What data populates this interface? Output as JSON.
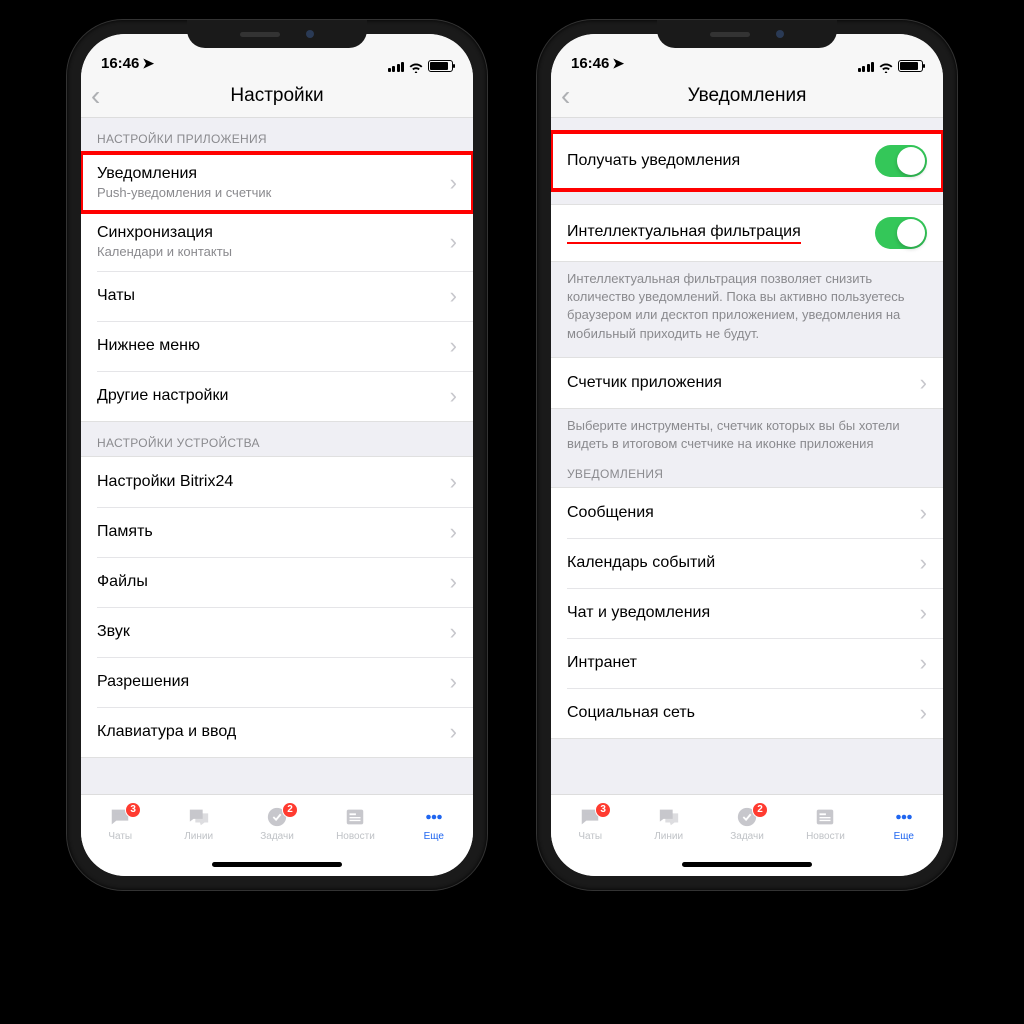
{
  "status": {
    "time": "16:46"
  },
  "left": {
    "title": "Настройки",
    "section1": "НАСТРОЙКИ ПРИЛОЖЕНИЯ",
    "rows1": [
      {
        "title": "Уведомления",
        "sub": "Push-уведомления и счетчик"
      },
      {
        "title": "Синхронизация",
        "sub": "Календари и контакты"
      },
      {
        "title": "Чаты"
      },
      {
        "title": "Нижнее меню"
      },
      {
        "title": "Другие настройки"
      }
    ],
    "section2": "НАСТРОЙКИ УСТРОЙСТВА",
    "rows2": [
      {
        "title": "Настройки Bitrix24"
      },
      {
        "title": "Память"
      },
      {
        "title": "Файлы"
      },
      {
        "title": "Звук"
      },
      {
        "title": "Разрешения"
      },
      {
        "title": "Клавиатура и ввод"
      }
    ]
  },
  "right": {
    "title": "Уведомления",
    "row_receive": "Получать уведомления",
    "row_filter": "Интеллектуальная фильтрация",
    "note_filter": "Интеллектуальная фильтрация позволяет снизить количество уведомлений. Пока вы активно пользуетесь браузером или десктоп приложением, уведомления на мобильный приходить не будут.",
    "row_counter": "Счетчик приложения",
    "note_counter": "Выберите инструменты, счетчик которых вы бы хотели видеть в итоговом счетчике на иконке приложения",
    "section_notif": "УВЕДОМЛЕНИЯ",
    "rows_notif": [
      "Сообщения",
      "Календарь событий",
      "Чат и уведомления",
      "Интранет",
      "Социальная сеть"
    ]
  },
  "tabs": {
    "items": [
      "Чаты",
      "Линии",
      "Задачи",
      "Новости",
      "Еще"
    ],
    "badges": {
      "0": "3",
      "2": "2"
    },
    "activeIndex": 4
  }
}
